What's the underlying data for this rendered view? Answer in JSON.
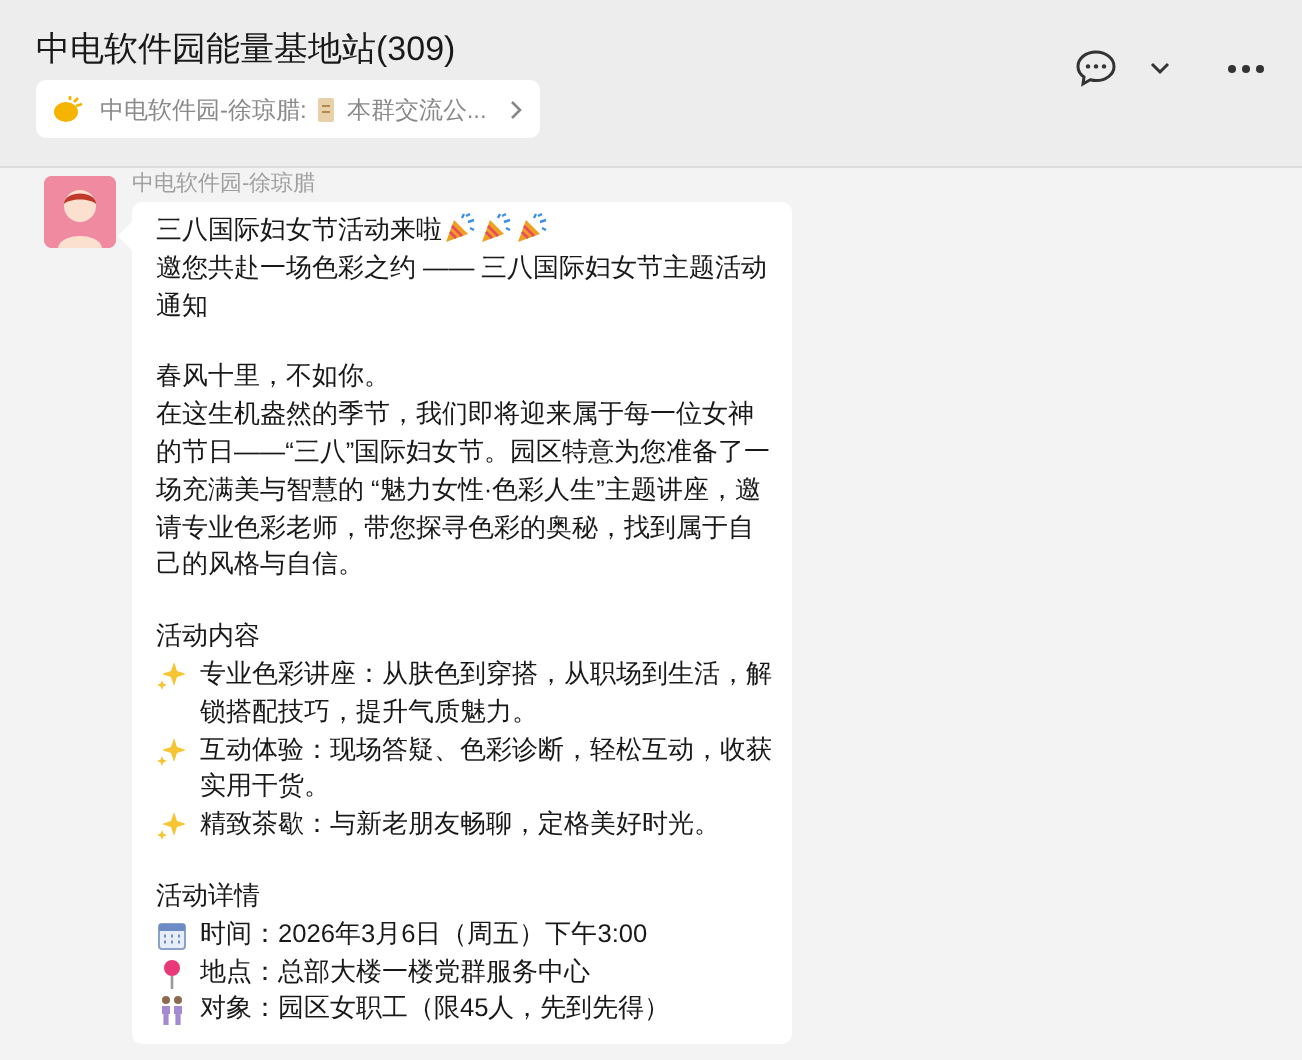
{
  "header": {
    "title": "中电软件园能量基地站(309)"
  },
  "pinned": {
    "sender": "中电软件园-徐琼腊:",
    "text": "本群交流公..."
  },
  "message": {
    "sender": "中电软件园-徐琼腊",
    "blocks": [
      [
        {
          "kind": "party",
          "text": "三八国际妇女节活动来啦"
        },
        {
          "kind": "text",
          "text": "邀您共赴一场色彩之约 —— 三八国际妇女节主题活动通知"
        }
      ],
      [
        {
          "kind": "text",
          "text": "春风十里，不如你。"
        },
        {
          "kind": "text",
          "text": "在这生机盎然的季节，我们即将迎来属于每一位女神的节日——“三八”国际妇女节。园区特意为您准备了一场充满美与智慧的 “魅力女性·色彩人生”主题讲座，邀请专业色彩老师，带您探寻色彩的奥秘，找到属于自己的风格与自信。"
        }
      ],
      [
        {
          "kind": "text",
          "text": "活动内容"
        },
        {
          "kind": "sparkle",
          "text": "专业色彩讲座：从肤色到穿搭，从职场到生活，解锁搭配技巧，提升气质魅力。"
        },
        {
          "kind": "sparkle",
          "text": "互动体验：现场答疑、色彩诊断，轻松互动，收获实用干货。"
        },
        {
          "kind": "sparkle",
          "text": "精致茶歇：与新老朋友畅聊，定格美好时光。"
        }
      ],
      [
        {
          "kind": "text",
          "text": "活动详情"
        },
        {
          "kind": "calendar",
          "text": "时间：2026年3月6日（周五）下午3:00"
        },
        {
          "kind": "pin",
          "text": "地点：总部大楼一楼党群服务中心"
        },
        {
          "kind": "people",
          "text": "对象：园区女职工（限45人，先到先得）"
        }
      ]
    ]
  }
}
